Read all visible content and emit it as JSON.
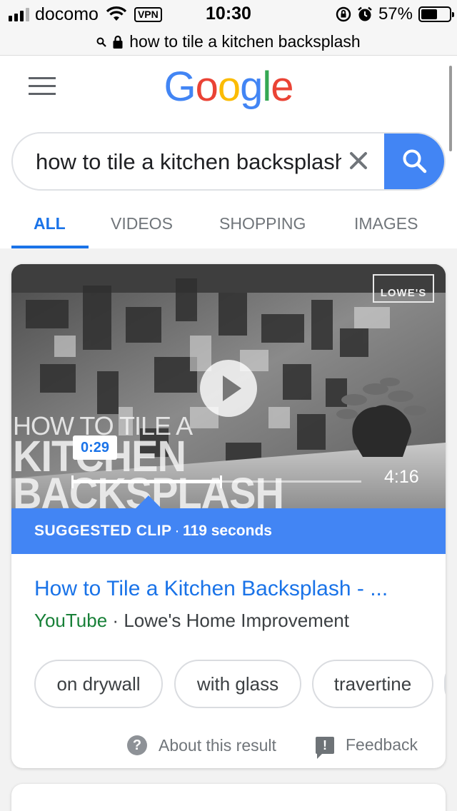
{
  "status_bar": {
    "carrier": "docomo",
    "vpn": "VPN",
    "time": "10:30",
    "battery_percent": "57%",
    "battery_level": 0.57
  },
  "url_bar": {
    "url": "how to tile a kitchen backsplash",
    "icons": [
      "search-icon",
      "lock-icon"
    ]
  },
  "header": {
    "logo": "Google",
    "logo_colors": [
      "#4285F4",
      "#EA4335",
      "#FBBC05",
      "#4285F4",
      "#34A853",
      "#EA4335"
    ],
    "search_value": "how to tile a kitchen backsplash",
    "tabs": [
      "ALL",
      "VIDEOS",
      "SHOPPING",
      "IMAGES"
    ],
    "active_tab": "ALL"
  },
  "video": {
    "brand": "LOWE'S",
    "overlay_lines": [
      "HOW TO TILE A",
      "KITCHEN",
      "BACKSPLASH"
    ],
    "clip_start": "0:29",
    "duration": "4:16"
  },
  "clip_banner": {
    "label": "SUGGESTED CLIP",
    "separator": "·",
    "seconds": "119 seconds"
  },
  "result": {
    "title": "How to Tile a Kitchen Backsplash - ...",
    "site": "YouTube",
    "separator": "·",
    "channel": "Lowe's Home Improvement"
  },
  "chips": [
    "on drywall",
    "with glass",
    "travertine"
  ],
  "footer": {
    "about": "About this result",
    "feedback": "Feedback"
  },
  "colors": {
    "accent": "#4285f4",
    "link": "#1a73e8",
    "site_green": "#188038"
  }
}
